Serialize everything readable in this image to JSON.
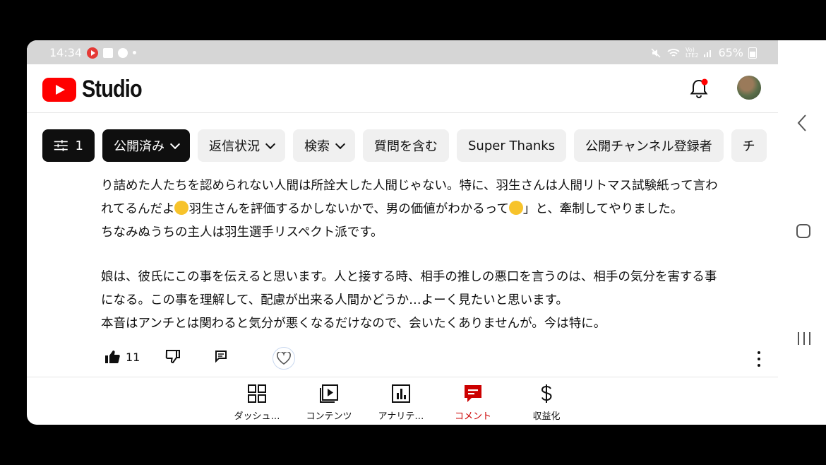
{
  "statusbar": {
    "time": "14:34",
    "battery": "65%"
  },
  "app": {
    "title": "Studio"
  },
  "filters": {
    "filter_count": "1",
    "chips": [
      {
        "label": "公開済み",
        "dropdown": true,
        "selected": true
      },
      {
        "label": "返信状況",
        "dropdown": true
      },
      {
        "label": "検索",
        "dropdown": true
      },
      {
        "label": "質問を含む"
      },
      {
        "label": "Super Thanks"
      },
      {
        "label": "公開チャンネル登録者"
      },
      {
        "label": "チ"
      }
    ]
  },
  "comment": {
    "line1": "り詰めた人たちを認められない人間は所詮大した人間じゃない。特に、羽生さんは人間リトマス試験紙って言わ",
    "line2a": "れてるんだよ",
    "line2b": "羽生さんを評価するかしないかで、男の価値がわかるって",
    "line2c": "」と、牽制してやりました。",
    "line3": "ちなみぬうちの主人は羽生選手リスペクト派です。",
    "line4": "娘は、彼氏にこの事を伝えると思います。人と接する時、相手の推しの悪口を言うのは、相手の気分を害する事",
    "line5": "になる。この事を理解して、配慮が出来る人間かどうか…よーく見たいと思います。",
    "line6": "本音はアンチとは関わると気分が悪くなるだけなので、会いたくありませんが。今は特に。"
  },
  "actions": {
    "like_count": "11"
  },
  "bottom_nav": [
    {
      "label": "ダッシュ…",
      "icon": "dashboard-icon"
    },
    {
      "label": "コンテンツ",
      "icon": "content-icon"
    },
    {
      "label": "アナリテ…",
      "icon": "analytics-icon"
    },
    {
      "label": "コメント",
      "icon": "comments-icon",
      "active": true
    },
    {
      "label": "収益化",
      "icon": "monetization-icon"
    }
  ],
  "colors": {
    "brand": "#ff0000",
    "active_nav": "#cc0000"
  }
}
